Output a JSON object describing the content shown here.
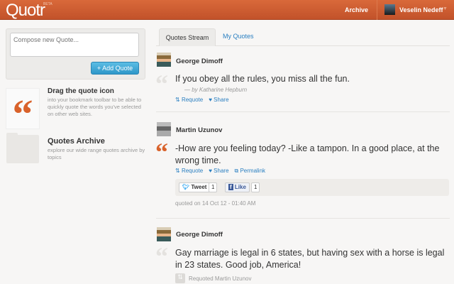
{
  "header": {
    "logo": "Quotr",
    "beta": "BETA",
    "archive": "Archive",
    "user": "Veselin Nedeff"
  },
  "compose": {
    "placeholder": "Compose new Quote...",
    "button": "+ Add Quote"
  },
  "sidebar": {
    "drag_title": "Drag the quote icon",
    "drag_desc": "into your bookmark toolbar to be able to quickly quote the words you've selected on other web sites.",
    "archive_title": "Quotes Archive",
    "archive_desc": "explore our wide range quotes archive by topics"
  },
  "tabs": [
    "Quotes Stream",
    "My Quotes"
  ],
  "posts": [
    {
      "user": "George Dimoff",
      "text": "If you obey all the rules, you miss all the fun.",
      "author": "— by Katharine Hepburn",
      "requote": "Requote",
      "share": "Share"
    },
    {
      "user": "Martin Uzunov",
      "text": "-How are you feeling today? -Like a tampon. In a good place, at the wrong time.",
      "requote": "Requote",
      "share": "Share",
      "permalink": "Permalink",
      "tweet": "Tweet",
      "tweet_count": "1",
      "like": "Like",
      "like_count": "1",
      "date": "quoted on 14 Oct 12 - 01:40 AM"
    },
    {
      "user": "George Dimoff",
      "text": "Gay marriage is legal in 6 states, but having sex with a horse is legal in 23 states. Good job, America!",
      "requoted": "Requoted Martin Uzunov"
    }
  ],
  "colors": {
    "brand": "#c95a2c",
    "link": "#2a7fc1"
  }
}
